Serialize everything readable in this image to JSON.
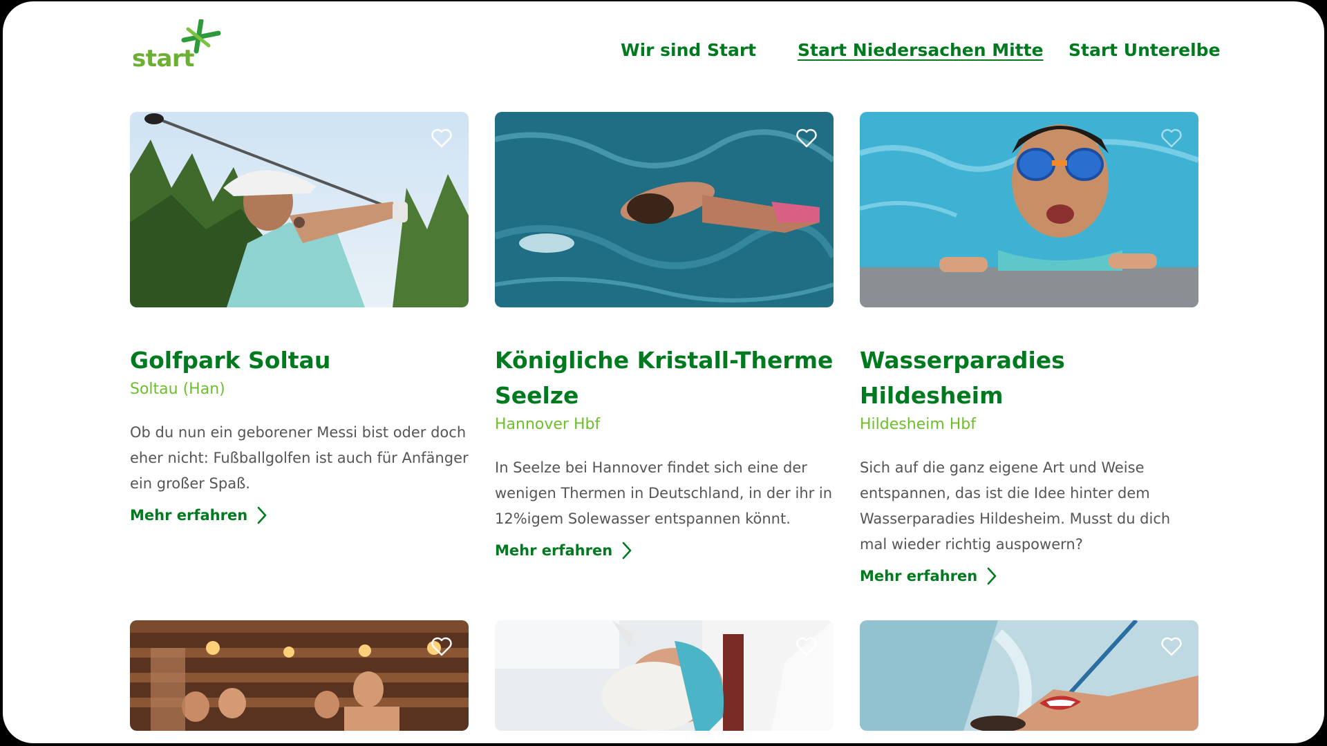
{
  "brand": {
    "logo_text": "start",
    "primary_color": "#007a1e",
    "accent_color": "#6cbf2a"
  },
  "nav": {
    "items": [
      {
        "label": "Wir sind Start"
      },
      {
        "label": "Start Niedersachen Mitte",
        "active": true
      },
      {
        "label": "Start Unterelbe"
      }
    ]
  },
  "cards": [
    {
      "title": "Golfpark Soltau",
      "station": "Soltau (Han)",
      "description": "Ob du nun ein geborener Messi bist oder doch eher nicht: Fußballgolfen ist auch für Anfänger ein großer Spaß.",
      "link": "Mehr erfahren",
      "image_icon": "golf-photo"
    },
    {
      "title": "Königliche Kristall-Therme Seelze",
      "station": "Hannover Hbf",
      "description": "In Seelze bei Hannover findet sich eine der wenigen Thermen in Deutschland, in der ihr in 12%igem Solewasser entspannen könnt.",
      "link": "Mehr erfahren",
      "image_icon": "spa-pool-photo"
    },
    {
      "title": "Wasserparadies Hildesheim",
      "station": "Hildesheim Hbf",
      "description": "Sich auf die ganz eigene Art und Weise entspannen, das ist die Idee hinter dem Wasserparadies Hildesheim. Musst du dich mal wieder richtig auspowern?",
      "link": "Mehr erfahren",
      "image_icon": "swimming-child-photo"
    },
    {
      "image_icon": "sauna-photo"
    },
    {
      "image_icon": "facial-mask-photo"
    },
    {
      "image_icon": "water-splash-photo"
    }
  ]
}
